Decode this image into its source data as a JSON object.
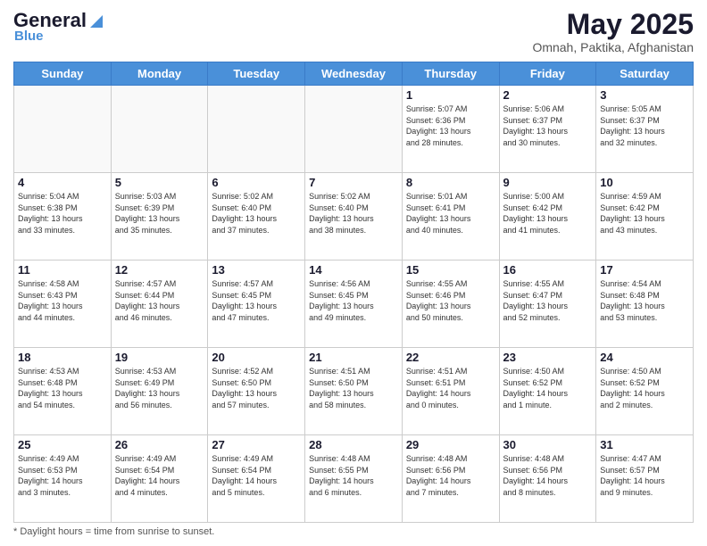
{
  "header": {
    "logo": {
      "general": "General",
      "blue": "Blue",
      "tagline": "Blue"
    },
    "title": "May 2025",
    "subtitle": "Omnah, Paktika, Afghanistan"
  },
  "weekdays": [
    "Sunday",
    "Monday",
    "Tuesday",
    "Wednesday",
    "Thursday",
    "Friday",
    "Saturday"
  ],
  "weeks": [
    [
      {
        "day": "",
        "info": ""
      },
      {
        "day": "",
        "info": ""
      },
      {
        "day": "",
        "info": ""
      },
      {
        "day": "",
        "info": ""
      },
      {
        "day": "1",
        "info": "Sunrise: 5:07 AM\nSunset: 6:36 PM\nDaylight: 13 hours\nand 28 minutes."
      },
      {
        "day": "2",
        "info": "Sunrise: 5:06 AM\nSunset: 6:37 PM\nDaylight: 13 hours\nand 30 minutes."
      },
      {
        "day": "3",
        "info": "Sunrise: 5:05 AM\nSunset: 6:37 PM\nDaylight: 13 hours\nand 32 minutes."
      }
    ],
    [
      {
        "day": "4",
        "info": "Sunrise: 5:04 AM\nSunset: 6:38 PM\nDaylight: 13 hours\nand 33 minutes."
      },
      {
        "day": "5",
        "info": "Sunrise: 5:03 AM\nSunset: 6:39 PM\nDaylight: 13 hours\nand 35 minutes."
      },
      {
        "day": "6",
        "info": "Sunrise: 5:02 AM\nSunset: 6:40 PM\nDaylight: 13 hours\nand 37 minutes."
      },
      {
        "day": "7",
        "info": "Sunrise: 5:02 AM\nSunset: 6:40 PM\nDaylight: 13 hours\nand 38 minutes."
      },
      {
        "day": "8",
        "info": "Sunrise: 5:01 AM\nSunset: 6:41 PM\nDaylight: 13 hours\nand 40 minutes."
      },
      {
        "day": "9",
        "info": "Sunrise: 5:00 AM\nSunset: 6:42 PM\nDaylight: 13 hours\nand 41 minutes."
      },
      {
        "day": "10",
        "info": "Sunrise: 4:59 AM\nSunset: 6:42 PM\nDaylight: 13 hours\nand 43 minutes."
      }
    ],
    [
      {
        "day": "11",
        "info": "Sunrise: 4:58 AM\nSunset: 6:43 PM\nDaylight: 13 hours\nand 44 minutes."
      },
      {
        "day": "12",
        "info": "Sunrise: 4:57 AM\nSunset: 6:44 PM\nDaylight: 13 hours\nand 46 minutes."
      },
      {
        "day": "13",
        "info": "Sunrise: 4:57 AM\nSunset: 6:45 PM\nDaylight: 13 hours\nand 47 minutes."
      },
      {
        "day": "14",
        "info": "Sunrise: 4:56 AM\nSunset: 6:45 PM\nDaylight: 13 hours\nand 49 minutes."
      },
      {
        "day": "15",
        "info": "Sunrise: 4:55 AM\nSunset: 6:46 PM\nDaylight: 13 hours\nand 50 minutes."
      },
      {
        "day": "16",
        "info": "Sunrise: 4:55 AM\nSunset: 6:47 PM\nDaylight: 13 hours\nand 52 minutes."
      },
      {
        "day": "17",
        "info": "Sunrise: 4:54 AM\nSunset: 6:48 PM\nDaylight: 13 hours\nand 53 minutes."
      }
    ],
    [
      {
        "day": "18",
        "info": "Sunrise: 4:53 AM\nSunset: 6:48 PM\nDaylight: 13 hours\nand 54 minutes."
      },
      {
        "day": "19",
        "info": "Sunrise: 4:53 AM\nSunset: 6:49 PM\nDaylight: 13 hours\nand 56 minutes."
      },
      {
        "day": "20",
        "info": "Sunrise: 4:52 AM\nSunset: 6:50 PM\nDaylight: 13 hours\nand 57 minutes."
      },
      {
        "day": "21",
        "info": "Sunrise: 4:51 AM\nSunset: 6:50 PM\nDaylight: 13 hours\nand 58 minutes."
      },
      {
        "day": "22",
        "info": "Sunrise: 4:51 AM\nSunset: 6:51 PM\nDaylight: 14 hours\nand 0 minutes."
      },
      {
        "day": "23",
        "info": "Sunrise: 4:50 AM\nSunset: 6:52 PM\nDaylight: 14 hours\nand 1 minute."
      },
      {
        "day": "24",
        "info": "Sunrise: 4:50 AM\nSunset: 6:52 PM\nDaylight: 14 hours\nand 2 minutes."
      }
    ],
    [
      {
        "day": "25",
        "info": "Sunrise: 4:49 AM\nSunset: 6:53 PM\nDaylight: 14 hours\nand 3 minutes."
      },
      {
        "day": "26",
        "info": "Sunrise: 4:49 AM\nSunset: 6:54 PM\nDaylight: 14 hours\nand 4 minutes."
      },
      {
        "day": "27",
        "info": "Sunrise: 4:49 AM\nSunset: 6:54 PM\nDaylight: 14 hours\nand 5 minutes."
      },
      {
        "day": "28",
        "info": "Sunrise: 4:48 AM\nSunset: 6:55 PM\nDaylight: 14 hours\nand 6 minutes."
      },
      {
        "day": "29",
        "info": "Sunrise: 4:48 AM\nSunset: 6:56 PM\nDaylight: 14 hours\nand 7 minutes."
      },
      {
        "day": "30",
        "info": "Sunrise: 4:48 AM\nSunset: 6:56 PM\nDaylight: 14 hours\nand 8 minutes."
      },
      {
        "day": "31",
        "info": "Sunrise: 4:47 AM\nSunset: 6:57 PM\nDaylight: 14 hours\nand 9 minutes."
      }
    ]
  ],
  "footer": {
    "daylight_label": "Daylight hours"
  }
}
